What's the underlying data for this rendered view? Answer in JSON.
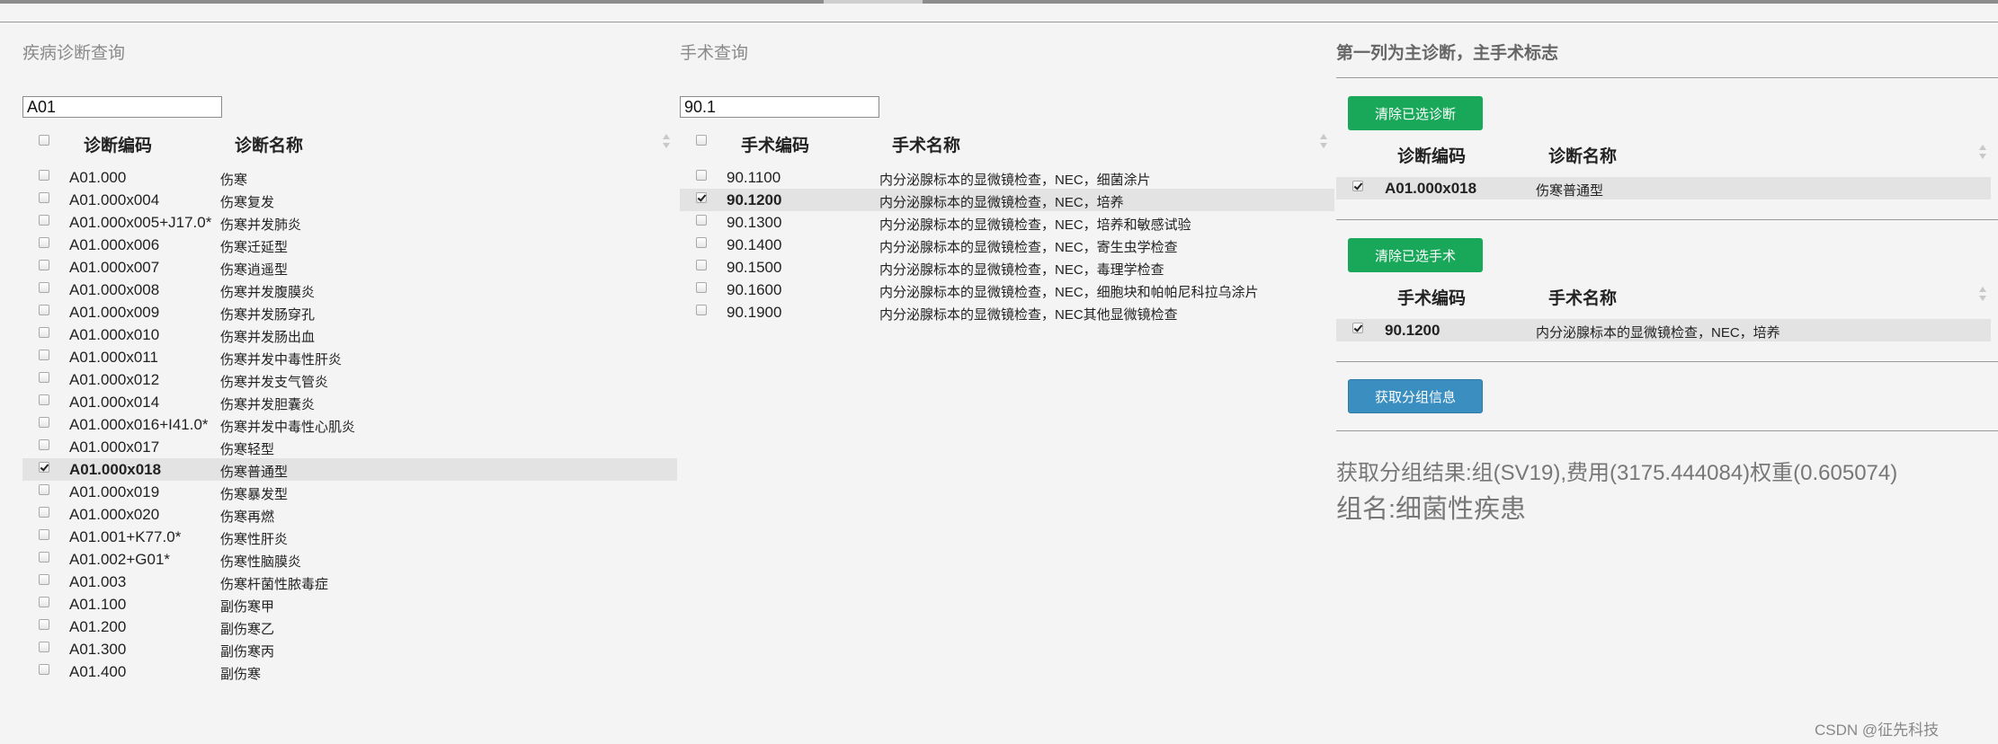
{
  "diagnosis": {
    "section_title": "疾病诊断查询",
    "search_value": "A01",
    "headers": {
      "code": "诊断编码",
      "name": "诊断名称"
    },
    "rows": [
      {
        "code": "A01.000",
        "name": "伤寒",
        "checked": false
      },
      {
        "code": "A01.000x004",
        "name": "伤寒复发",
        "checked": false
      },
      {
        "code": "A01.000x005+J17.0*",
        "name": "伤寒并发肺炎",
        "checked": false
      },
      {
        "code": "A01.000x006",
        "name": "伤寒迁延型",
        "checked": false
      },
      {
        "code": "A01.000x007",
        "name": "伤寒逍遥型",
        "checked": false
      },
      {
        "code": "A01.000x008",
        "name": "伤寒并发腹膜炎",
        "checked": false
      },
      {
        "code": "A01.000x009",
        "name": "伤寒并发肠穿孔",
        "checked": false
      },
      {
        "code": "A01.000x010",
        "name": "伤寒并发肠出血",
        "checked": false
      },
      {
        "code": "A01.000x011",
        "name": "伤寒并发中毒性肝炎",
        "checked": false
      },
      {
        "code": "A01.000x012",
        "name": "伤寒并发支气管炎",
        "checked": false
      },
      {
        "code": "A01.000x014",
        "name": "伤寒并发胆囊炎",
        "checked": false
      },
      {
        "code": "A01.000x016+I41.0*",
        "name": "伤寒并发中毒性心肌炎",
        "checked": false
      },
      {
        "code": "A01.000x017",
        "name": "伤寒轻型",
        "checked": false
      },
      {
        "code": "A01.000x018",
        "name": "伤寒普通型",
        "checked": true
      },
      {
        "code": "A01.000x019",
        "name": "伤寒暴发型",
        "checked": false
      },
      {
        "code": "A01.000x020",
        "name": "伤寒再燃",
        "checked": false
      },
      {
        "code": "A01.001+K77.0*",
        "name": "伤寒性肝炎",
        "checked": false
      },
      {
        "code": "A01.002+G01*",
        "name": "伤寒性脑膜炎",
        "checked": false
      },
      {
        "code": "A01.003",
        "name": "伤寒杆菌性脓毒症",
        "checked": false
      },
      {
        "code": "A01.100",
        "name": "副伤寒甲",
        "checked": false
      },
      {
        "code": "A01.200",
        "name": "副伤寒乙",
        "checked": false
      },
      {
        "code": "A01.300",
        "name": "副伤寒丙",
        "checked": false
      },
      {
        "code": "A01.400",
        "name": "副伤寒",
        "checked": false
      }
    ]
  },
  "surgery": {
    "section_title": "手术查询",
    "search_value": "90.1",
    "headers": {
      "code": "手术编码",
      "name": "手术名称"
    },
    "rows": [
      {
        "code": "90.1100",
        "name": "内分泌腺标本的显微镜检查，NEC，细菌涂片",
        "checked": false
      },
      {
        "code": "90.1200",
        "name": "内分泌腺标本的显微镜检查，NEC，培养",
        "checked": true
      },
      {
        "code": "90.1300",
        "name": "内分泌腺标本的显微镜检查，NEC，培养和敏感试验",
        "checked": false
      },
      {
        "code": "90.1400",
        "name": "内分泌腺标本的显微镜检查，NEC，寄生虫学检查",
        "checked": false
      },
      {
        "code": "90.1500",
        "name": "内分泌腺标本的显微镜检查，NEC，毒理学检查",
        "checked": false
      },
      {
        "code": "90.1600",
        "name": "内分泌腺标本的显微镜检查，NEC，细胞块和帕帕尼科拉乌涂片",
        "checked": false
      },
      {
        "code": "90.1900",
        "name": "内分泌腺标本的显微镜检查，NEC其他显微镜检查",
        "checked": false
      }
    ]
  },
  "selected": {
    "section_title": "第一列为主诊断，主手术标志",
    "clear_diag_label": "清除已选诊断",
    "diag_headers": {
      "code": "诊断编码",
      "name": "诊断名称"
    },
    "diag_row": {
      "code": "A01.000x018",
      "name": "伤寒普通型"
    },
    "clear_surg_label": "清除已选手术",
    "surg_headers": {
      "code": "手术编码",
      "name": "手术名称"
    },
    "surg_row": {
      "code": "90.1200",
      "name": "内分泌腺标本的显微镜检查，NEC，培养"
    },
    "get_group_label": "获取分组信息",
    "result_line1": "获取分组结果:组(SV19),费用(3175.444084)权重(0.605074)",
    "result_line2": "组名:细菌性疾患"
  },
  "watermark": "CSDN @征先科技",
  "colors": {
    "green_button": "#19a85a",
    "blue_button": "#3a8fc0",
    "selected_row": "#e3e3e3"
  }
}
